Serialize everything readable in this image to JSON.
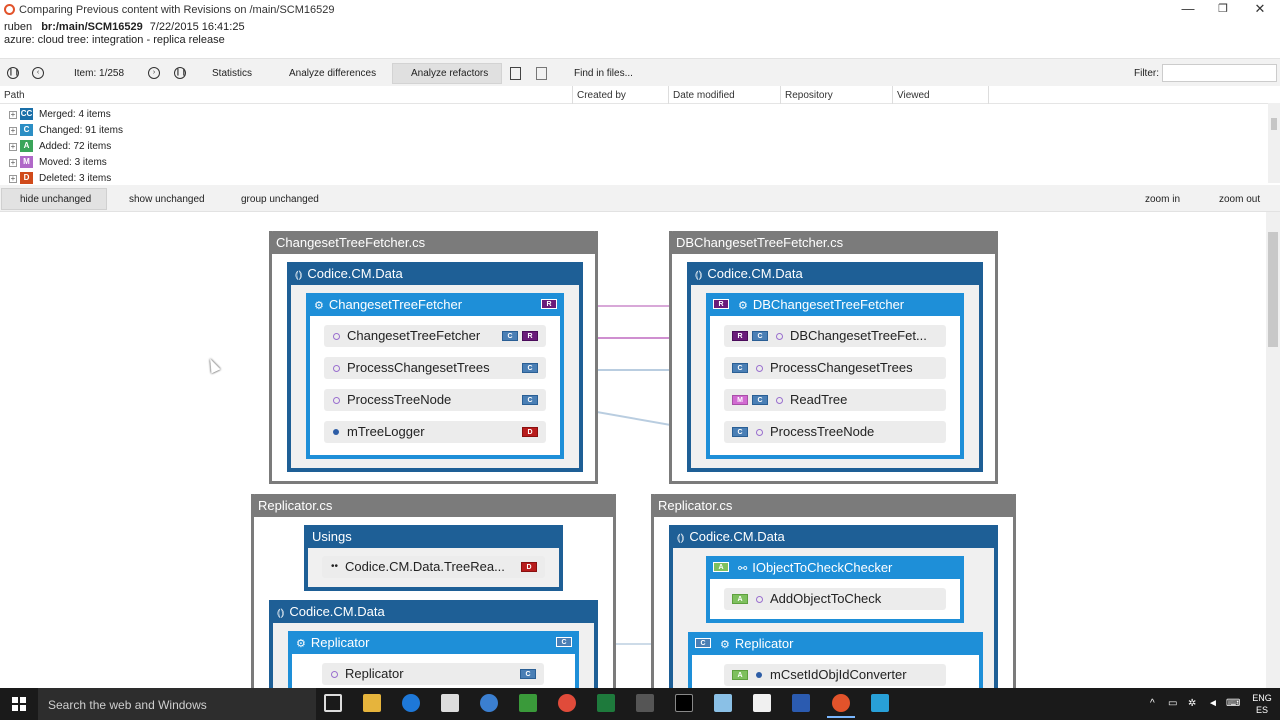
{
  "window": {
    "title": "Comparing Previous content with Revisions on /main/SCM16529",
    "user": "ruben",
    "branch": "br:/main/SCM16529",
    "date": "7/22/2015 16:41:25",
    "subtitle": "azure: cloud tree: integration - replica release",
    "minimize": "—",
    "restore": "❐",
    "close": "✕"
  },
  "toolbar": {
    "item_label": "Item: 1/258",
    "statistics": "Statistics",
    "analyze_differences": "Analyze differences",
    "analyze_refactors": "Analyze refactors",
    "find_in_files": "Find in files...",
    "filter_label": "Filter:",
    "filter_value": ""
  },
  "columns": {
    "path": "Path",
    "created_by": "Created by",
    "date_modified": "Date modified",
    "repository": "Repository",
    "viewed": "Viewed"
  },
  "tree": [
    {
      "badge": "CC",
      "label": "Merged: 4 items",
      "color": "#1a6fa8"
    },
    {
      "badge": "C",
      "label": "Changed: 91 items",
      "color": "#2b8ec4"
    },
    {
      "badge": "A",
      "label": "Added: 72 items",
      "color": "#3aa55a"
    },
    {
      "badge": "M",
      "label": "Moved: 3 items",
      "color": "#b068c8"
    },
    {
      "badge": "D",
      "label": "Deleted: 3 items",
      "color": "#d04a1a"
    }
  ],
  "diagram_toolbar": {
    "hide_unchanged": "hide unchanged",
    "show_unchanged": "show unchanged",
    "group_unchanged": "group unchanged",
    "zoom_in": "zoom in",
    "zoom_out": "zoom out"
  },
  "diagram": {
    "left_top": {
      "file": "ChangesetTreeFetcher.cs",
      "namespace": "Codice.CM.Data",
      "class": "ChangesetTreeFetcher",
      "class_tag": "R",
      "members": [
        {
          "name": "ChangesetTreeFetcher",
          "tags": [
            "C",
            "R"
          ],
          "kind": "method"
        },
        {
          "name": "ProcessChangesetTrees",
          "tags": [
            "C"
          ],
          "kind": "method"
        },
        {
          "name": "ProcessTreeNode",
          "tags": [
            "C"
          ],
          "kind": "method"
        },
        {
          "name": "mTreeLogger",
          "tags": [
            "D"
          ],
          "kind": "field"
        }
      ]
    },
    "right_top": {
      "file": "DBChangesetTreeFetcher.cs",
      "namespace": "Codice.CM.Data",
      "class": "DBChangesetTreeFetcher",
      "class_tag": "R",
      "members": [
        {
          "name": "DBChangesetTreeFet...",
          "tags": [
            "R",
            "C"
          ],
          "kind": "method"
        },
        {
          "name": "ProcessChangesetTrees",
          "tags": [
            "C"
          ],
          "kind": "method"
        },
        {
          "name": "ReadTree",
          "tags": [
            "M",
            "C"
          ],
          "kind": "method"
        },
        {
          "name": "ProcessTreeNode",
          "tags": [
            "C"
          ],
          "kind": "method"
        }
      ]
    },
    "left_bottom": {
      "file": "Replicator.cs",
      "usings": "Usings",
      "using_item": "Codice.CM.Data.TreeRea...",
      "using_tag": "D",
      "namespace": "Codice.CM.Data",
      "class": "Replicator",
      "class_tag": "C",
      "member": "Replicator",
      "member_tag": "C"
    },
    "right_bottom": {
      "file": "Replicator.cs",
      "namespace": "Codice.CM.Data",
      "interface": "IObjectToCheckChecker",
      "interface_tag": "A",
      "interface_member": "AddObjectToCheck",
      "interface_member_tag": "A",
      "class": "Replicator",
      "class_tag": "C",
      "member": "mCsetIdObjIdConverter",
      "member_tag": "A"
    }
  },
  "taskbar": {
    "search_placeholder": "Search the web and Windows",
    "lang_top": "ENG",
    "lang_bottom": "ES"
  }
}
